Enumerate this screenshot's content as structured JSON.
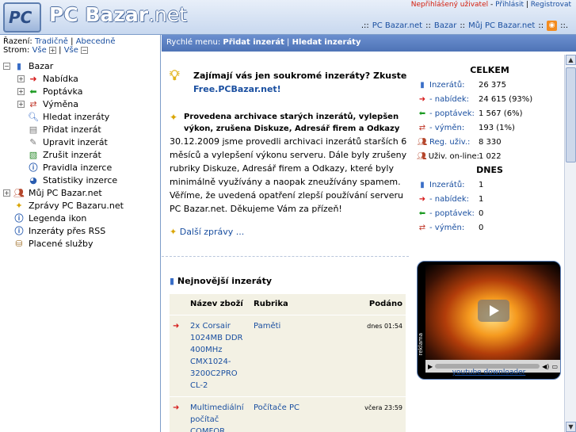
{
  "header": {
    "logo_mark": "PC",
    "title_main": "PC Bazar",
    "title_suffix": ".net",
    "user_status": "Nepřihlášený uživatel",
    "login": "Přihlásit",
    "register": "Registrovat",
    "nav": [
      ".::",
      "PC Bazar.net",
      "::",
      "Bazar",
      "::",
      "Můj PC Bazar.net",
      "::"
    ],
    "rss_label": "RSS",
    "nav_end": "::."
  },
  "sidebar": {
    "sort_label": "Řazení:",
    "sort_traditional": "Tradičně",
    "sort_sep": "|",
    "sort_alpha": "Abecedně",
    "tree_label": "Strom:",
    "tree_all_open": "Vše",
    "tree_all_close": "Vše",
    "items": [
      {
        "label": "Bazar"
      },
      {
        "label": "Nabídka"
      },
      {
        "label": "Poptávka"
      },
      {
        "label": "Výměna"
      },
      {
        "label": "Hledat inzeráty"
      },
      {
        "label": "Přidat inzerát"
      },
      {
        "label": "Upravit inzerát"
      },
      {
        "label": "Zrušit inzerát"
      },
      {
        "label": "Pravidla inzerce"
      },
      {
        "label": "Statistiky inzerce"
      },
      {
        "label": "Můj PC Bazar.net"
      },
      {
        "label": "Zprávy PC Bazaru.net"
      },
      {
        "label": "Legenda ikon"
      },
      {
        "label": "Inzeráty přes RSS"
      },
      {
        "label": "Placené služby"
      }
    ]
  },
  "quickbar": {
    "label": "Rychlé menu:",
    "add": "Přidat inzerát",
    "sep": "|",
    "search": "Hledat inzeráty"
  },
  "main": {
    "promo_text": "Zajímají vás jen soukromé inzeráty? Zkuste",
    "promo_link": "Free.PCBazar.net!",
    "news_title": "Provedena archivace starých inzerátů, vylepšen výkon, zrušena Diskuze, Adresář firem a Odkazy",
    "news_body": "30.12.2009 jsme provedli archivaci inzerátů starších 6 měsíců a vylepšení výkonu serveru. Dále byly zrušeny rubriky Diskuze, Adresář firem a Odkazy, které byly minimálně využívány a naopak zneužívány spamem. Věříme, že uvedená opatření zlepší používání serveru PC Bazar.net. Děkujeme Vám za přízeň!",
    "more_news": "Další zprávy ...",
    "newest_title": "Nejnovější inzeráty",
    "table": {
      "headers": [
        "Název zboží",
        "Rubrika",
        "Podáno"
      ],
      "rows": [
        {
          "name": "2x Corsair 1024MB DDR 400MHz CMX1024-3200C2PRO CL-2",
          "category": "Paměti",
          "time": "dnes 01:54"
        },
        {
          "name": "Multimediální počítač COMFOR",
          "category": "Počítače PC",
          "time": "včera 23:59"
        }
      ]
    }
  },
  "stats": {
    "total_title": "CELKEM",
    "total": [
      {
        "label": "Inzerátů:",
        "value": "26 375"
      },
      {
        "label": "- nabídek:",
        "value": "24 615 (93%)"
      },
      {
        "label": "- poptávek:",
        "value": "1 567 (6%)"
      },
      {
        "label": "- výměn:",
        "value": "193 (1%)"
      },
      {
        "label": "Reg. uživ.:",
        "value": "8 330"
      },
      {
        "label": "Uživ. on-line:",
        "value": "1 022"
      }
    ],
    "today_title": "DNES",
    "today": [
      {
        "label": "Inzerátů:",
        "value": "1"
      },
      {
        "label": "- nabídek:",
        "value": "1"
      },
      {
        "label": "- poptávek:",
        "value": "0"
      },
      {
        "label": "- výměn:",
        "value": "0"
      }
    ]
  },
  "ad": {
    "side_label": "reklama",
    "link": "youtube downloader"
  }
}
